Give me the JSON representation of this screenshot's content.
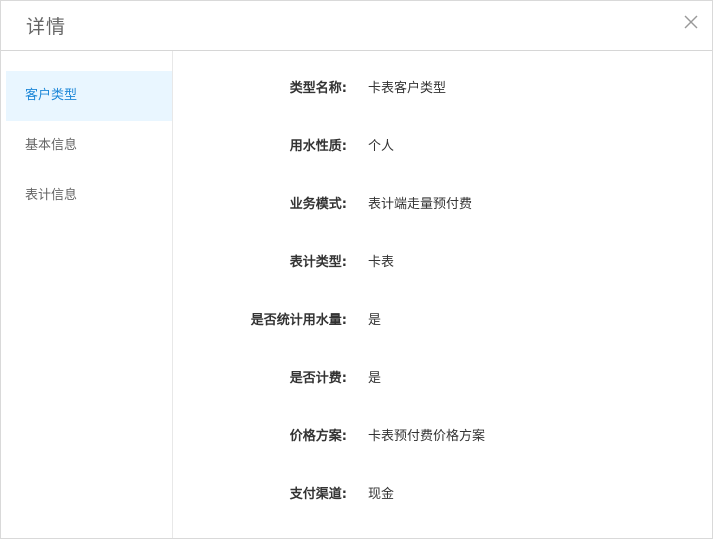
{
  "dialog": {
    "title": "详情",
    "close_icon": "close-icon"
  },
  "sidebar": {
    "items": [
      {
        "label": "客户类型",
        "active": true
      },
      {
        "label": "基本信息",
        "active": false
      },
      {
        "label": "表计信息",
        "active": false
      }
    ]
  },
  "details": [
    {
      "label": "类型名称:",
      "value": "卡表客户类型"
    },
    {
      "label": "用水性质:",
      "value": "个人"
    },
    {
      "label": "业务模式:",
      "value": "表计端走量预付费"
    },
    {
      "label": "表计类型:",
      "value": "卡表"
    },
    {
      "label": "是否统计用水量:",
      "value": "是"
    },
    {
      "label": "是否计费:",
      "value": "是"
    },
    {
      "label": "价格方案:",
      "value": "卡表预付费价格方案"
    },
    {
      "label": "支付渠道:",
      "value": "现金"
    }
  ],
  "colors": {
    "accent": "#1e88d8",
    "active_bg": "#e9f6ff"
  }
}
